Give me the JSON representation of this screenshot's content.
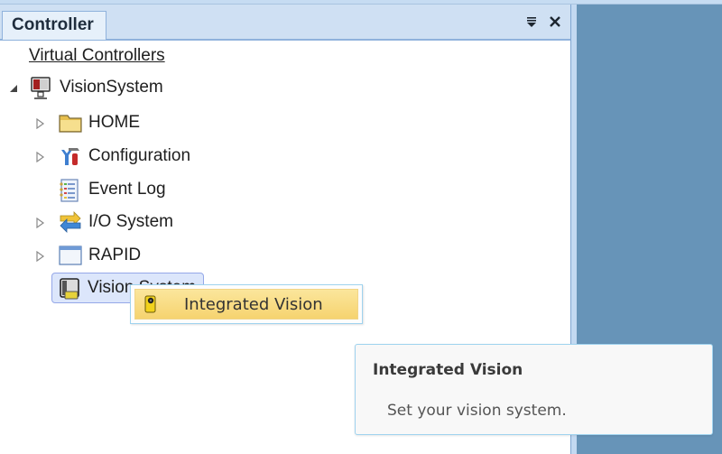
{
  "panel": {
    "tab_label": "Controller",
    "pin_icon": "dropdown-pin-icon",
    "close_icon": "close-icon"
  },
  "tree": {
    "root_link": "Virtual Controllers",
    "controller": {
      "label": "VisionSystem",
      "icon": "controller-computer-icon",
      "expanded": true
    },
    "children": [
      {
        "label": "HOME",
        "icon": "folder-icon",
        "expandable": true
      },
      {
        "label": "Configuration",
        "icon": "configuration-tools-icon",
        "expandable": true
      },
      {
        "label": "Event Log",
        "icon": "event-log-icon",
        "expandable": false
      },
      {
        "label": "I/O System",
        "icon": "io-arrows-icon",
        "expandable": true
      },
      {
        "label": "RAPID",
        "icon": "rapid-window-icon",
        "expandable": true
      },
      {
        "label": "Vision System",
        "icon": "vision-camera-icon",
        "expandable": false,
        "selected": true
      }
    ]
  },
  "context_menu": {
    "items": [
      {
        "label": "Integrated Vision",
        "icon": "vision-sensor-icon",
        "highlighted": true
      }
    ]
  },
  "tooltip": {
    "title": "Integrated Vision",
    "description": "Set your vision system."
  },
  "colors": {
    "workspace_bg": "#6794b8",
    "header_bg": "#cfe0f3",
    "selection_bg": "#dce6fb",
    "menu_highlight": "#f6d36f"
  }
}
